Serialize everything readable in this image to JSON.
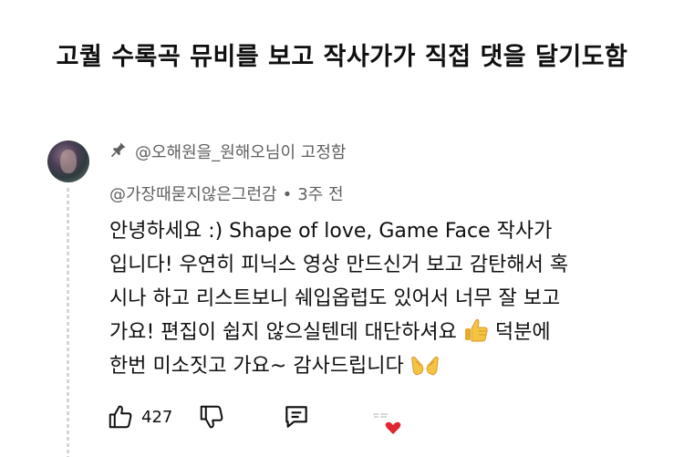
{
  "post_title": "고퀄 수록곡 뮤비를 보고 작사가가 직접 댓을 달기도함",
  "comment": {
    "pinned_label": "@오해원을_원해오님이 고정함",
    "author": "@가장때묻지않은그런감",
    "separator": "•",
    "time_ago": "3주 전",
    "body_lines": [
      "안녕하세요 :) Shape of love, Game Face 작사가",
      "입니다! 우연히 피닉스 영상 만드신거 보고 감탄해서 혹",
      "시나 하고 리스트보니 쉐입옵럽도 있어서 너무 잘 보고",
      "가요! 편집이 쉽지 않으실텐데 대단하셔요",
      "덕분에",
      "한번 미소짓고 가요~ 감사드립니다"
    ],
    "like_count": "427",
    "icons": [
      "pin-icon",
      "thumbs-up-icon",
      "thumbs-down-icon",
      "reply-icon",
      "creator-heart-icon",
      "thumbs-up-emoji",
      "praying-hands-emoji"
    ]
  }
}
